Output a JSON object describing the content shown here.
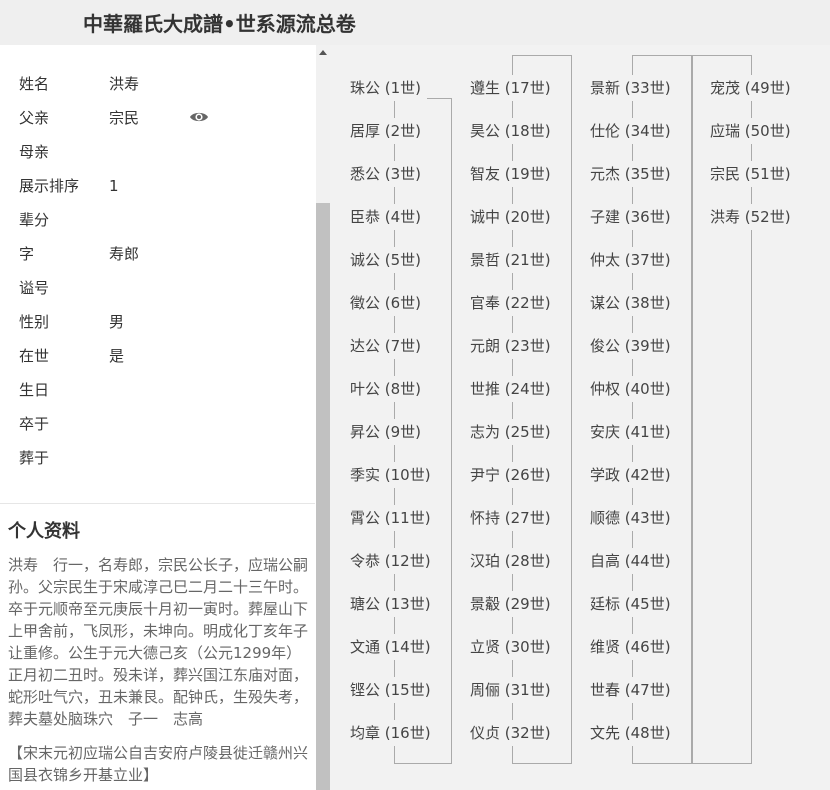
{
  "header": {
    "title": "中華羅氏大成譜•世系源流总卷"
  },
  "person": {
    "fields": [
      {
        "label": "姓名",
        "value": "洪寿"
      },
      {
        "label": "父亲",
        "value": "宗民"
      },
      {
        "label": "母亲",
        "value": ""
      },
      {
        "label": "展示排序",
        "value": "1"
      },
      {
        "label": "辈分",
        "value": ""
      },
      {
        "label": "字",
        "value": "寿郎"
      },
      {
        "label": "谥号",
        "value": ""
      },
      {
        "label": "性别",
        "value": "男"
      },
      {
        "label": "在世",
        "value": "是"
      },
      {
        "label": "生日",
        "value": ""
      },
      {
        "label": "卒于",
        "value": ""
      },
      {
        "label": "葬于",
        "value": ""
      }
    ],
    "view_icon": "eye-icon"
  },
  "profile": {
    "title": "个人资料",
    "bio": "洪寿　行一，名寿郎，宗民公长子，应瑞公嗣孙。父宗民生于宋咸淳己巳二月二十三午时。卒于元顺帝至元庚辰十月初一寅时。葬屋山下上甲舍前，飞凤形，未坤向。明成化丁亥年子让重修。公生于元大德己亥（公元1299年）正月初二丑时。殁未详，葬兴国江东庙对面，蛇形吐气穴，丑未兼艮。配钟氏，生殁失考，葬夫墓处脑珠穴　子一　志高",
    "origin": "【宋末元初应瑞公自吉安府卢陵县徙迁赣州兴国县衣锦乡开基立业】"
  },
  "lineage": [
    [
      "珠公 (1世)",
      "居厚 (2世)",
      "悉公 (3世)",
      "臣恭 (4世)",
      "诚公 (5世)",
      "徵公 (6世)",
      "达公 (7世)",
      "叶公 (8世)",
      "昇公 (9世)",
      "季实 (10世)",
      "霄公 (11世)",
      "令恭 (12世)",
      "瑭公 (13世)",
      "文通 (14世)",
      "铿公 (15世)",
      "均章 (16世)"
    ],
    [
      "遵生 (17世)",
      "昊公 (18世)",
      "智友 (19世)",
      "诚中 (20世)",
      "景哲 (21世)",
      "官奉 (22世)",
      "元朗 (23世)",
      "世推 (24世)",
      "志为 (25世)",
      "尹宁 (26世)",
      "怀持 (27世)",
      "汉珀 (28世)",
      "景觳 (29世)",
      "立贤 (30世)",
      "周俪 (31世)",
      "仪贞 (32世)"
    ],
    [
      "景新 (33世)",
      "仕伦 (34世)",
      "元杰 (35世)",
      "子建 (36世)",
      "仲太 (37世)",
      "谋公 (38世)",
      "俊公 (39世)",
      "仲权 (40世)",
      "安庆 (41世)",
      "学政 (42世)",
      "顺德 (43世)",
      "自高 (44世)",
      "廷标 (45世)",
      "维贤 (46世)",
      "世春 (47世)",
      "文先 (48世)"
    ],
    [
      "宠茂 (49世)",
      "应瑞 (50世)",
      "宗民 (51世)",
      "洪寿 (52世)"
    ]
  ]
}
